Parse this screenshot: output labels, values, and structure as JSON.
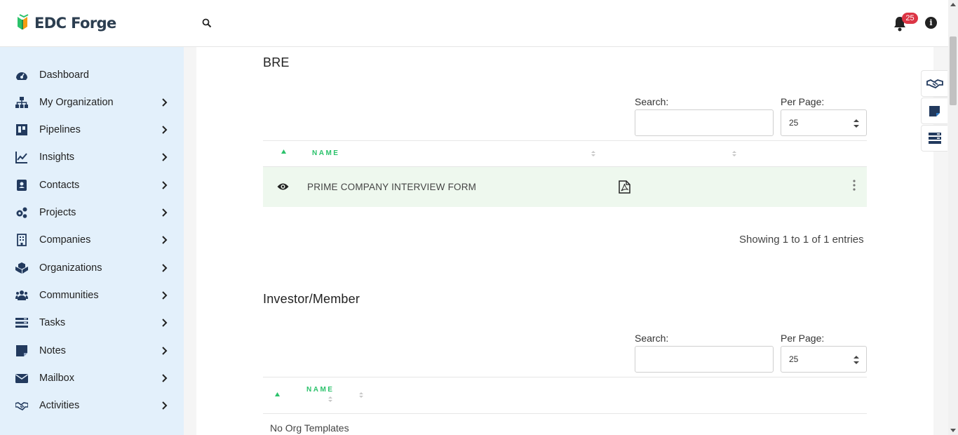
{
  "app": {
    "name": "EDC Forge"
  },
  "notifications": {
    "count": "25"
  },
  "sidebar": {
    "items": [
      {
        "label": "Dashboard",
        "icon": "dashboard-icon"
      },
      {
        "label": "My Organization",
        "icon": "sitemap-icon"
      },
      {
        "label": "Pipelines",
        "icon": "board-icon"
      },
      {
        "label": "Insights",
        "icon": "chart-line-icon"
      },
      {
        "label": "Contacts",
        "icon": "address-book-icon"
      },
      {
        "label": "Projects",
        "icon": "gears-icon"
      },
      {
        "label": "Companies",
        "icon": "building-icon"
      },
      {
        "label": "Organizations",
        "icon": "cubes-icon"
      },
      {
        "label": "Communities",
        "icon": "users-icon"
      },
      {
        "label": "Tasks",
        "icon": "tasks-icon"
      },
      {
        "label": "Notes",
        "icon": "sticky-note-icon"
      },
      {
        "label": "Mailbox",
        "icon": "envelope-icon"
      },
      {
        "label": "Activities",
        "icon": "handshake-icon"
      }
    ]
  },
  "sections": [
    {
      "title": "BRE",
      "search_label": "Search:",
      "search_value": "",
      "per_page_label": "Per Page:",
      "per_page_value": "25",
      "columns": {
        "name": "NAME"
      },
      "rows": [
        {
          "name": "PRIME COMPANY INTERVIEW FORM"
        }
      ],
      "info": "Showing 1 to 1 of 1 entries"
    },
    {
      "title": "Investor/Member",
      "search_label": "Search:",
      "search_value": "",
      "per_page_label": "Per Page:",
      "per_page_value": "25",
      "columns": {
        "name": "NAME"
      },
      "empty_text": "No Org Templates"
    }
  ],
  "colors": {
    "accent": "#2bc26b",
    "sidebar_bg": "#e3f0fb",
    "badge": "#dc3545",
    "row_bg": "#eef8ee"
  }
}
